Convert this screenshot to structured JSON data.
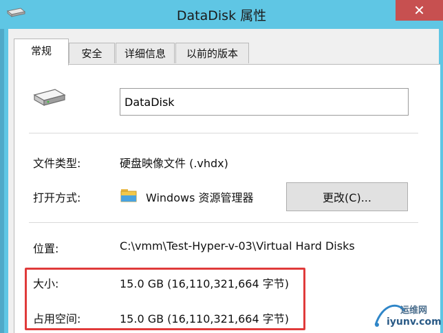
{
  "window": {
    "title": "DataDisk 属性",
    "close_glyph": "✕"
  },
  "tabs": [
    {
      "label": "常规",
      "active": true
    },
    {
      "label": "安全",
      "active": false
    },
    {
      "label": "详细信息",
      "active": false
    },
    {
      "label": "以前的版本",
      "active": false
    }
  ],
  "general": {
    "name_value": "DataDisk",
    "file_type_label": "文件类型:",
    "file_type_value": "硬盘映像文件 (.vhdx)",
    "open_with_label": "打开方式:",
    "open_with_value": "Windows 资源管理器",
    "change_button": "更改(C)...",
    "location_label": "位置:",
    "location_value": "C:\\vmm\\Test-Hyper-v-03\\Virtual Hard Disks",
    "size_label": "大小:",
    "size_value": "15.0 GB (16,110,321,664 字节)",
    "size_on_disk_label": "占用空间:",
    "size_on_disk_value": "15.0 GB (16,110,321,664 字节)"
  },
  "watermark": {
    "line1": "运维网",
    "line2": "iyunv.com"
  },
  "colors": {
    "titlebar": "#5fc6e4",
    "close": "#c75050",
    "highlight": "#e03a3a"
  },
  "icons": [
    "drive-icon",
    "disk-icon",
    "folder-explorer-icon",
    "close-icon"
  ]
}
